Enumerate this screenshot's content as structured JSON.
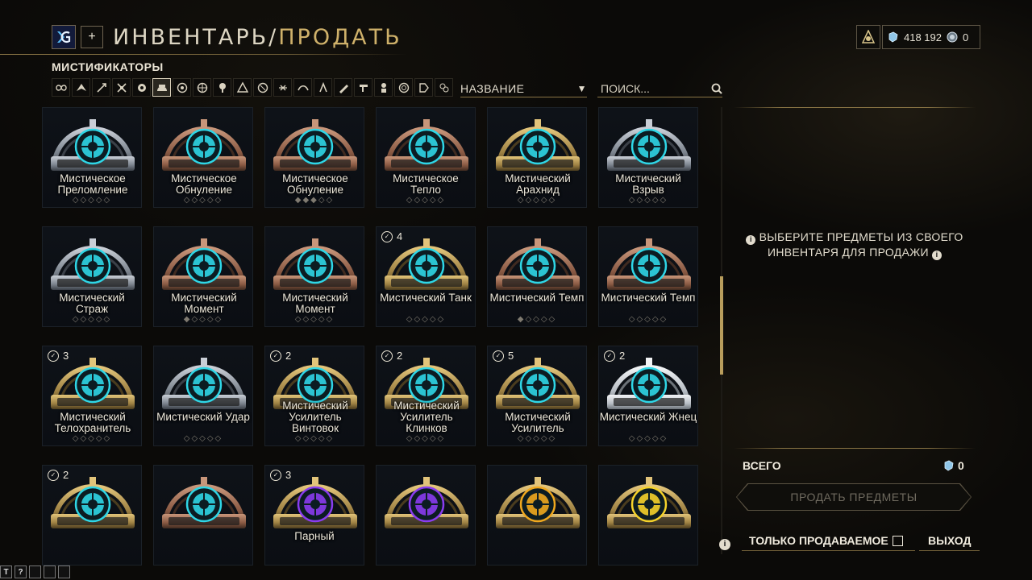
{
  "header": {
    "title_part1": "ИНВЕНТАРЬ/",
    "title_part2": "ПРОДАТЬ",
    "plus_label": "+"
  },
  "currency": {
    "platinum_text": "418 192",
    "other_text": "0"
  },
  "section_title": "МИСТИФИКАТОРЫ",
  "category_icons": [
    "all-icon",
    "warframe-icon",
    "primary-icon",
    "secondary-icon",
    "melee-icon",
    "arcane-icon",
    "companion-icon",
    "archwing-icon",
    "faction-icon",
    "sentinel-icon",
    "kdrive-icon",
    "necramech-icon",
    "archgun-icon",
    "operator-icon",
    "amp-icon",
    "zaw-icon",
    "kitgun-icon",
    "tektolyst-icon",
    "parazon-icon",
    "misc-icon"
  ],
  "sort": {
    "label": "НАЗВАНИЕ",
    "arrow": "▼"
  },
  "search": {
    "placeholder": "ПОИСК..."
  },
  "tiles": [
    {
      "name": "Мистическое Преломление",
      "owned": "",
      "rank": "◇◇◇◇◇",
      "frame": "silver",
      "color": "cyan"
    },
    {
      "name": "Мистическое Обнуление",
      "owned": "",
      "rank": "◇◇◇◇◇",
      "frame": "bronze",
      "color": "cyan"
    },
    {
      "name": "Мистическое Обнуление",
      "owned": "",
      "rank": "◆◆◆◇◇",
      "frame": "bronze",
      "color": "cyan"
    },
    {
      "name": "Мистическое Тепло",
      "owned": "",
      "rank": "◇◇◇◇◇",
      "frame": "bronze",
      "color": "cyan"
    },
    {
      "name": "Мистический Арахнид",
      "owned": "",
      "rank": "◇◇◇◇◇",
      "frame": "gold",
      "color": "cyan"
    },
    {
      "name": "Мистический Взрыв",
      "owned": "",
      "rank": "◇◇◇◇◇",
      "frame": "silver",
      "color": "cyan"
    },
    {
      "name": "Мистический Страж",
      "owned": "",
      "rank": "◇◇◇◇◇",
      "frame": "silver",
      "color": "cyan"
    },
    {
      "name": "Мистический Момент",
      "owned": "",
      "rank": "◆◇◇◇◇",
      "frame": "bronze",
      "color": "cyan"
    },
    {
      "name": "Мистический Момент",
      "owned": "",
      "rank": "◇◇◇◇◇",
      "frame": "bronze",
      "color": "cyan"
    },
    {
      "name": "Мистический Танк",
      "owned": "4",
      "rank": "◇◇◇◇◇",
      "frame": "gold",
      "color": "cyan"
    },
    {
      "name": "Мистический Темп",
      "owned": "",
      "rank": "◆◇◇◇◇",
      "frame": "bronze",
      "color": "cyan"
    },
    {
      "name": "Мистический Темп",
      "owned": "",
      "rank": "◇◇◇◇◇",
      "frame": "bronze",
      "color": "cyan"
    },
    {
      "name": "Мистический Телохранитель",
      "owned": "3",
      "rank": "◇◇◇◇◇",
      "frame": "gold",
      "color": "cyan"
    },
    {
      "name": "Мистический Удар",
      "owned": "",
      "rank": "◇◇◇◇◇",
      "frame": "silver",
      "color": "cyan"
    },
    {
      "name": "Мистический Усилитель Винтовок",
      "owned": "2",
      "rank": "◇◇◇◇◇",
      "frame": "gold",
      "color": "cyan"
    },
    {
      "name": "Мистический Усилитель Клинков",
      "owned": "2",
      "rank": "◇◇◇◇◇",
      "frame": "gold",
      "color": "cyan"
    },
    {
      "name": "Мистический Усилитель",
      "owned": "5",
      "rank": "◇◇◇◇◇",
      "frame": "gold",
      "color": "cyan"
    },
    {
      "name": "Мистический Жнец",
      "owned": "2",
      "rank": "◇◇◇◇◇",
      "frame": "white",
      "color": "cyan"
    },
    {
      "name": "",
      "owned": "2",
      "rank": "",
      "frame": "gold",
      "color": "cyan"
    },
    {
      "name": "",
      "owned": "",
      "rank": "",
      "frame": "bronze",
      "color": "cyan"
    },
    {
      "name": "Парный",
      "owned": "3",
      "rank": "",
      "frame": "gold",
      "color": "purple"
    },
    {
      "name": "",
      "owned": "",
      "rank": "",
      "frame": "gold",
      "color": "purple"
    },
    {
      "name": "",
      "owned": "",
      "rank": "",
      "frame": "gold",
      "color": "amber"
    },
    {
      "name": "",
      "owned": "",
      "rank": "",
      "frame": "gold",
      "color": "yellow"
    }
  ],
  "right_panel": {
    "message_line1": "ВЫБЕРИТЕ ПРЕДМЕТЫ ИЗ СВОЕГО",
    "message_line2": "ИНВЕНТАРЯ ДЛЯ ПРОДАЖИ",
    "info_glyph": "i",
    "total_label": "ВСЕГО",
    "total_value": "0",
    "sell_button": "ПРОДАТЬ ПРЕДМЕТЫ"
  },
  "footer": {
    "only_sellable": "ТОЛЬКО ПРОДАВАЕМОЕ",
    "exit": "ВЫХОД"
  },
  "tiny_bar": [
    "T",
    "?",
    "",
    "",
    ""
  ],
  "colors": {
    "accent_gold": "#cfb16a",
    "mod_cyan": "#2fd6e6",
    "mod_purple": "#8a3cf0",
    "mod_amber": "#f0a81e"
  }
}
